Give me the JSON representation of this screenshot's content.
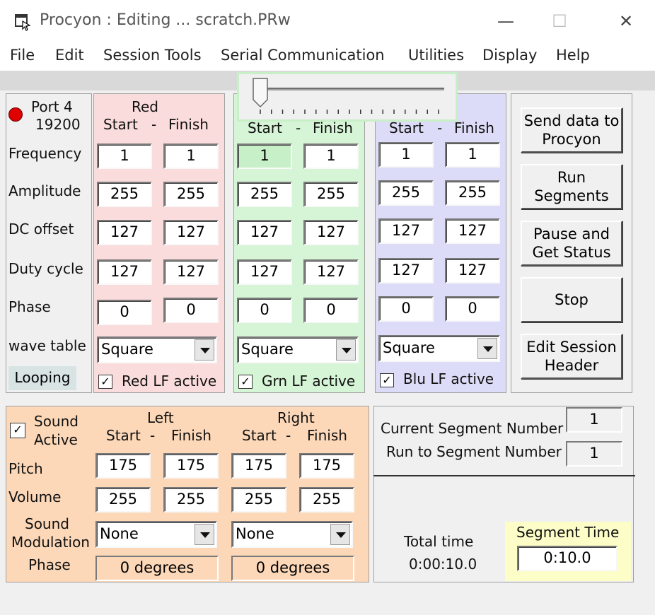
{
  "window": {
    "title": "Procyon : Editing ... scratch.PRw",
    "minimize_glyph": "—",
    "maximize_glyph": "☐",
    "close_glyph": "✕"
  },
  "menu": [
    "File",
    "Edit",
    "Session Tools",
    "Serial Communication",
    "Utilities",
    "Display",
    "Help"
  ],
  "port": {
    "label": "Port 4",
    "baud": "19200",
    "status_color": "#e00000"
  },
  "param_labels": {
    "frequency": "Frequency",
    "amplitude": "Amplitude",
    "dc_offset": "DC offset",
    "duty_cycle": "Duty cycle",
    "phase": "Phase",
    "wave_table": "wave table"
  },
  "looping_label": "Looping",
  "slider": {
    "position_fraction": 0.0
  },
  "channels": {
    "red": {
      "title": "Red",
      "start": "Start",
      "dash": "-",
      "finish": "Finish",
      "color": "#fbdcdc",
      "frequency": [
        "1",
        "1"
      ],
      "amplitude": [
        "255",
        "255"
      ],
      "dc_offset": [
        "127",
        "127"
      ],
      "duty_cycle": [
        "127",
        "127"
      ],
      "phase": [
        "0",
        "0"
      ],
      "wave": "Square",
      "lf_label": "Red LF active",
      "lf_checked": "✓"
    },
    "green": {
      "start": "Start",
      "dash": "-",
      "finish": "Finish",
      "color": "#d6f4d6",
      "frequency": [
        "1",
        "1"
      ],
      "amplitude": [
        "255",
        "255"
      ],
      "dc_offset": [
        "127",
        "127"
      ],
      "duty_cycle": [
        "127",
        "127"
      ],
      "phase": [
        "0",
        "0"
      ],
      "wave": "Square",
      "lf_label": "Grn LF active",
      "lf_checked": "✓"
    },
    "blue": {
      "start": "Start",
      "dash": "-",
      "finish": "Finish",
      "color": "#dcdcf8",
      "frequency": [
        "1",
        "1"
      ],
      "amplitude": [
        "255",
        "255"
      ],
      "dc_offset": [
        "127",
        "127"
      ],
      "duty_cycle": [
        "127",
        "127"
      ],
      "phase": [
        "0",
        "0"
      ],
      "wave": "Square",
      "lf_label": "Blu LF active",
      "lf_checked": "✓"
    }
  },
  "buttons": {
    "send": [
      "Send data to",
      "Procyon"
    ],
    "run": [
      "Run",
      "Segments"
    ],
    "pause": [
      "Pause and",
      "Get Status"
    ],
    "stop": "Stop",
    "edit": [
      "Edit Session",
      "Header"
    ]
  },
  "sound": {
    "color": "#fcd8b8",
    "active_label": [
      "Sound",
      "Active"
    ],
    "active_checked": "✓",
    "left_title": "Left",
    "right_title": "Right",
    "start": "Start",
    "dash": "-",
    "finish": "Finish",
    "pitch_label": "Pitch",
    "volume_label": "Volume",
    "modulation_label": [
      "Sound",
      "Modulation"
    ],
    "phase_label": "Phase",
    "left": {
      "pitch": [
        "175",
        "175"
      ],
      "volume": [
        "255",
        "255"
      ],
      "modulation": "None",
      "phase": "0 degrees"
    },
    "right": {
      "pitch": [
        "175",
        "175"
      ],
      "volume": [
        "255",
        "255"
      ],
      "modulation": "None",
      "phase": "0 degrees"
    }
  },
  "segment": {
    "current_label": "Current Segment Number",
    "current_value": "1",
    "run_to_label": "Run to Segment Number",
    "run_to_value": "1",
    "total_time_label": "Total time",
    "total_time_value": "0:00:10.0",
    "segment_time_label": "Segment Time",
    "segment_time_value": "0:10.0",
    "segment_time_bg": "#fdfdc8"
  }
}
